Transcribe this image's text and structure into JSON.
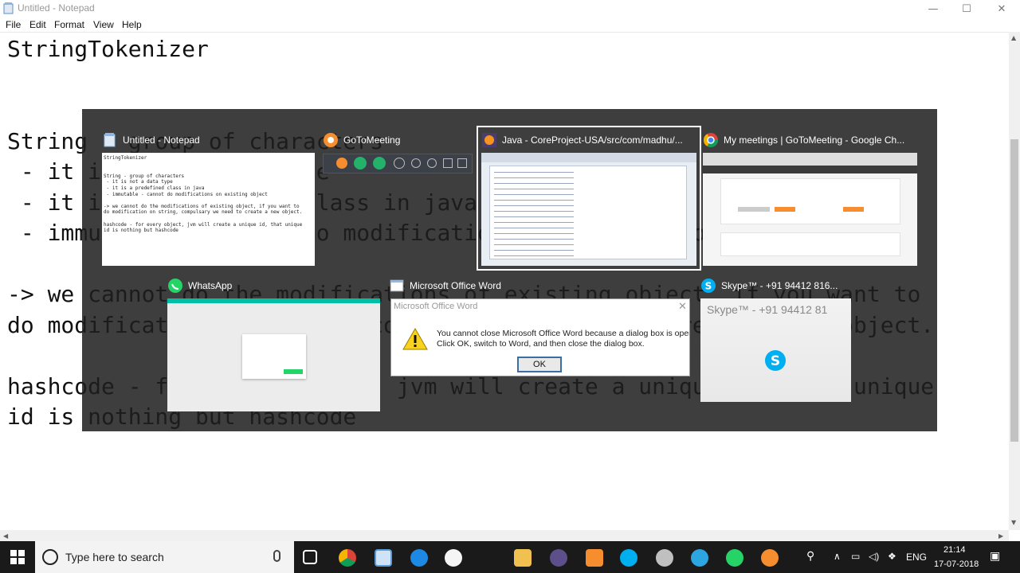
{
  "window": {
    "title": "Untitled - Notepad",
    "controls": {
      "minimize": "—",
      "maximize": "☐",
      "close": "✕"
    }
  },
  "menu": [
    "File",
    "Edit",
    "Format",
    "View",
    "Help"
  ],
  "editor": {
    "text": "StringTokenizer\n\n\nString - group of characters\n - it is not a data type\n - it is a predefined class in java\n - immutable - cannot do modifications on existing object\n\n-> we cannot do the modifications of existing object, if you want to\ndo modification on string, compulsary we need to create a new object.\n\nhashcode - for every object, jvm will create a unique id, that unique\nid is nothing but hashcode"
  },
  "switcher": {
    "cards": [
      {
        "title": "Untitled - Notepad",
        "icon": "notepad-icon",
        "thumb_lines": [
          "StringTokenizer",
          "",
          "",
          "String - group of characters",
          " - it is not a data type",
          " - it is a predefined class in java",
          " - immutable - cannot do modifications on existing object",
          "",
          "-> we cannot do the modifications of existing object, if you want to",
          "do modification on string, compulsary we need to create a new object.",
          "",
          "hashcode - for every object, jvm will create a unique id, that unique",
          "id is nothing but hashcode"
        ]
      },
      {
        "title": "GoToMeeting",
        "icon": "gotomeeting-icon"
      },
      {
        "title": "Java - CoreProject-USA/src/com/madhu/...",
        "icon": "eclipse-icon",
        "selected": true
      },
      {
        "title": "My meetings | GoToMeeting - Google Ch...",
        "icon": "chrome-icon"
      },
      {
        "title": "WhatsApp",
        "icon": "whatsapp-icon"
      },
      {
        "title": "Microsoft Office Word",
        "icon": "word-icon",
        "dialog": {
          "title": "Microsoft Office Word",
          "message_line1": "You cannot close Microsoft Office Word because a dialog box is open.",
          "message_line2": "Click OK, switch to Word, and then close the dialog box.",
          "ok_label": "OK"
        }
      },
      {
        "title": "Skype™ - +91 94412 816...",
        "icon": "skype-icon",
        "thumb_title": "Skype™ - +91 94412 81"
      }
    ]
  },
  "taskbar": {
    "search_placeholder": "Type here to search",
    "tray": {
      "language": "ENG",
      "time": "21:14",
      "date": "17-07-2018"
    }
  },
  "colors": {
    "accent_green": "#25d366",
    "skype_blue": "#00aff0",
    "chrome_red": "#db4437",
    "taskbar_bg": "#1a1a1a"
  }
}
